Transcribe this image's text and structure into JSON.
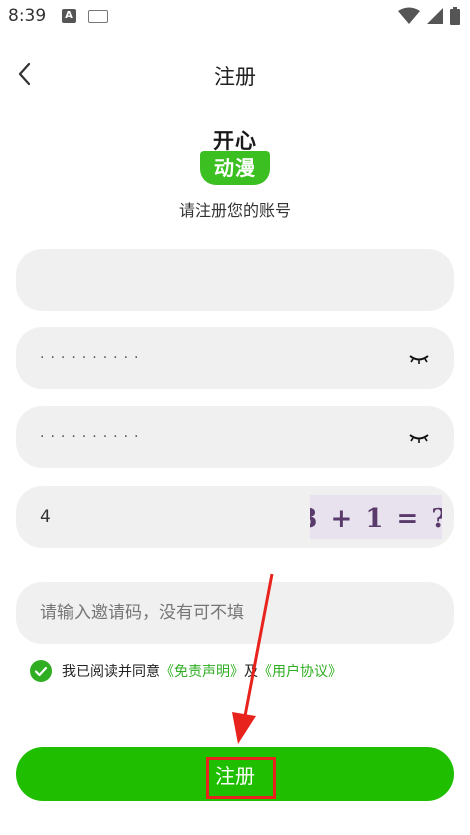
{
  "status_bar": {
    "time": "8:39",
    "notif_letter": "A"
  },
  "nav": {
    "title": "注册"
  },
  "logo": {
    "line1": "开心",
    "line2": "动漫"
  },
  "subtitle": "请注册您的账号",
  "form": {
    "username": {
      "value": "",
      "placeholder": ""
    },
    "password": {
      "value": "··········"
    },
    "confirm_password": {
      "value": "··········"
    },
    "captcha": {
      "value": "4",
      "image_text": "3 + 1 = ?"
    },
    "invite": {
      "placeholder": "请输入邀请码，没有可不填"
    }
  },
  "agreement": {
    "prefix": "我已阅读并同意",
    "disclaimer_link": "《免责声明》",
    "joiner": "及",
    "terms_link": "《用户协议》"
  },
  "register_button": {
    "label": "注册"
  },
  "colors": {
    "accent": "#1fbf00",
    "link": "#2fae22",
    "annotation": "#e8231d"
  }
}
